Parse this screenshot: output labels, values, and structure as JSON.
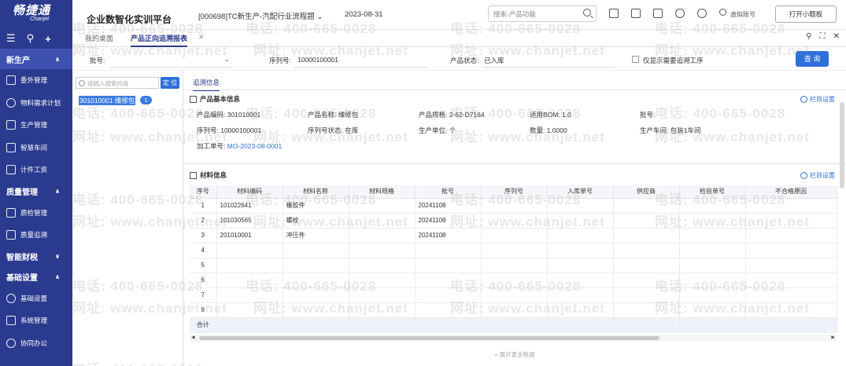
{
  "sidebar": {
    "logo_cn": "畅捷通",
    "logo_en": "Chanjet",
    "groups": [
      {
        "label": "新生产",
        "items": [
          "委外管理",
          "物料需求计划",
          "生产管理",
          "智慧车间",
          "计件工资"
        ]
      },
      {
        "label": "质量管理",
        "items": [
          "质检管理",
          "质量追溯"
        ]
      },
      {
        "label": "智能财税",
        "items": []
      },
      {
        "label": "基础设置",
        "items": [
          "基础设置",
          "系统管理",
          "协同办公"
        ]
      }
    ]
  },
  "topbar": {
    "platform": "企业数智化实训平台",
    "org": "[000698]TC新生产-汽配行业流程题",
    "date": "2023-08-31",
    "search_placeholder": "搜索-产品功能",
    "user": "虚拟账号",
    "open_btn": "打开小题板"
  },
  "tabs": [
    {
      "label": "我的桌面",
      "active": false
    },
    {
      "label": "产品正向追溯报表",
      "active": true
    }
  ],
  "filters": {
    "batch_label": "批号:",
    "serial_label": "序列号:",
    "serial_value": "10000100001",
    "status_label": "产品状态:",
    "status_value": "已入库",
    "checkbox_label": "仅显示需要追溯工序",
    "query_btn": "查 询"
  },
  "tree": {
    "search_placeholder": "请输入搜索内容",
    "locate_btn": "定 位",
    "node": "301010001 维修包",
    "badge": "1"
  },
  "main": {
    "subtab": "追溯信息",
    "basic_title": "产品基本信息",
    "col_settings": "栏目设置",
    "basic": {
      "code": "产品编码: 301010001",
      "name": "产品名称: 维修包",
      "spec": "产品规格: 2-62-D7164",
      "bom": "适用BOM: 1.0",
      "batch": "批号:",
      "serial": "序列号: 10000100001",
      "serial_status": "序列号状态: 在库",
      "unit": "生产单位: 个",
      "qty": "数量: 1.0000",
      "workshop": "生产车间: 包装1车间",
      "order_label": "加工单号:",
      "order_value": "MO-2023-08-0001"
    },
    "material_title": "材料信息",
    "columns": [
      "序号",
      "材料编码",
      "材料名称",
      "材料规格",
      "批号",
      "序列号",
      "入库单号",
      "供应商",
      "检验单号",
      "不合格原因"
    ],
    "rows": [
      {
        "seq": "1",
        "code": "101022641",
        "name": "橡胶件",
        "spec": "",
        "batch": "20241108"
      },
      {
        "seq": "2",
        "code": "101030565",
        "name": "螺栓",
        "spec": "",
        "batch": "20241108"
      },
      {
        "seq": "3",
        "code": "201010001",
        "name": "冲压件",
        "spec": "",
        "batch": "20241108"
      },
      {
        "seq": "4",
        "code": "",
        "name": "",
        "spec": "",
        "batch": ""
      },
      {
        "seq": "5",
        "code": "",
        "name": "",
        "spec": "",
        "batch": ""
      },
      {
        "seq": "6",
        "code": "",
        "name": "",
        "spec": "",
        "batch": ""
      },
      {
        "seq": "7",
        "code": "",
        "name": "",
        "spec": "",
        "batch": ""
      },
      {
        "seq": "8",
        "code": "",
        "name": "",
        "spec": "",
        "batch": ""
      }
    ],
    "total_label": "合计",
    "more": "展开更多数据"
  },
  "watermark": {
    "phone": "电话: 400-665-0028",
    "site": "网址: www.chanjet.net"
  },
  "colors": {
    "sidebar": "#2a3a8e",
    "primary": "#2f6fdb"
  }
}
